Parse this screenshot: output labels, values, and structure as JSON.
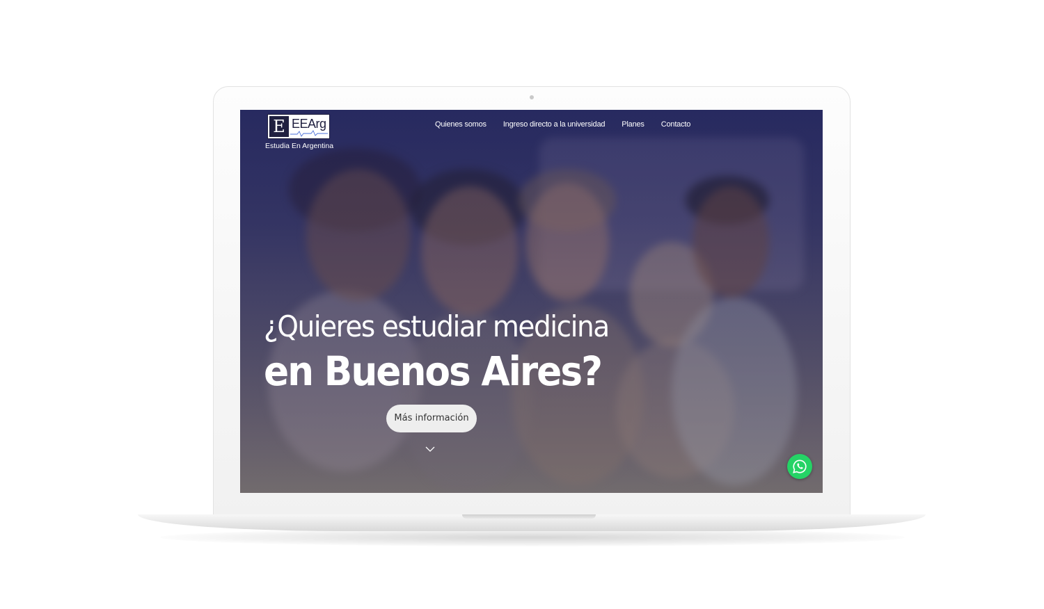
{
  "logo": {
    "brand": "EEArg",
    "mark": "E",
    "tagline": "Estudia En Argentina"
  },
  "nav": {
    "items": [
      "Quienes somos",
      "Ingreso directo a la universidad",
      "Planes",
      "Contacto"
    ]
  },
  "hero": {
    "line1": "¿Quieres estudiar medicina",
    "line2": "en Buenos Aires?",
    "cta_label": "Más información"
  },
  "icons": {
    "scroll": "chevron-down-icon",
    "chat": "whatsapp-icon"
  },
  "colors": {
    "overlay": "#2c2f63",
    "whatsapp": "#25d366",
    "cta_bg": "#eeeeee"
  }
}
